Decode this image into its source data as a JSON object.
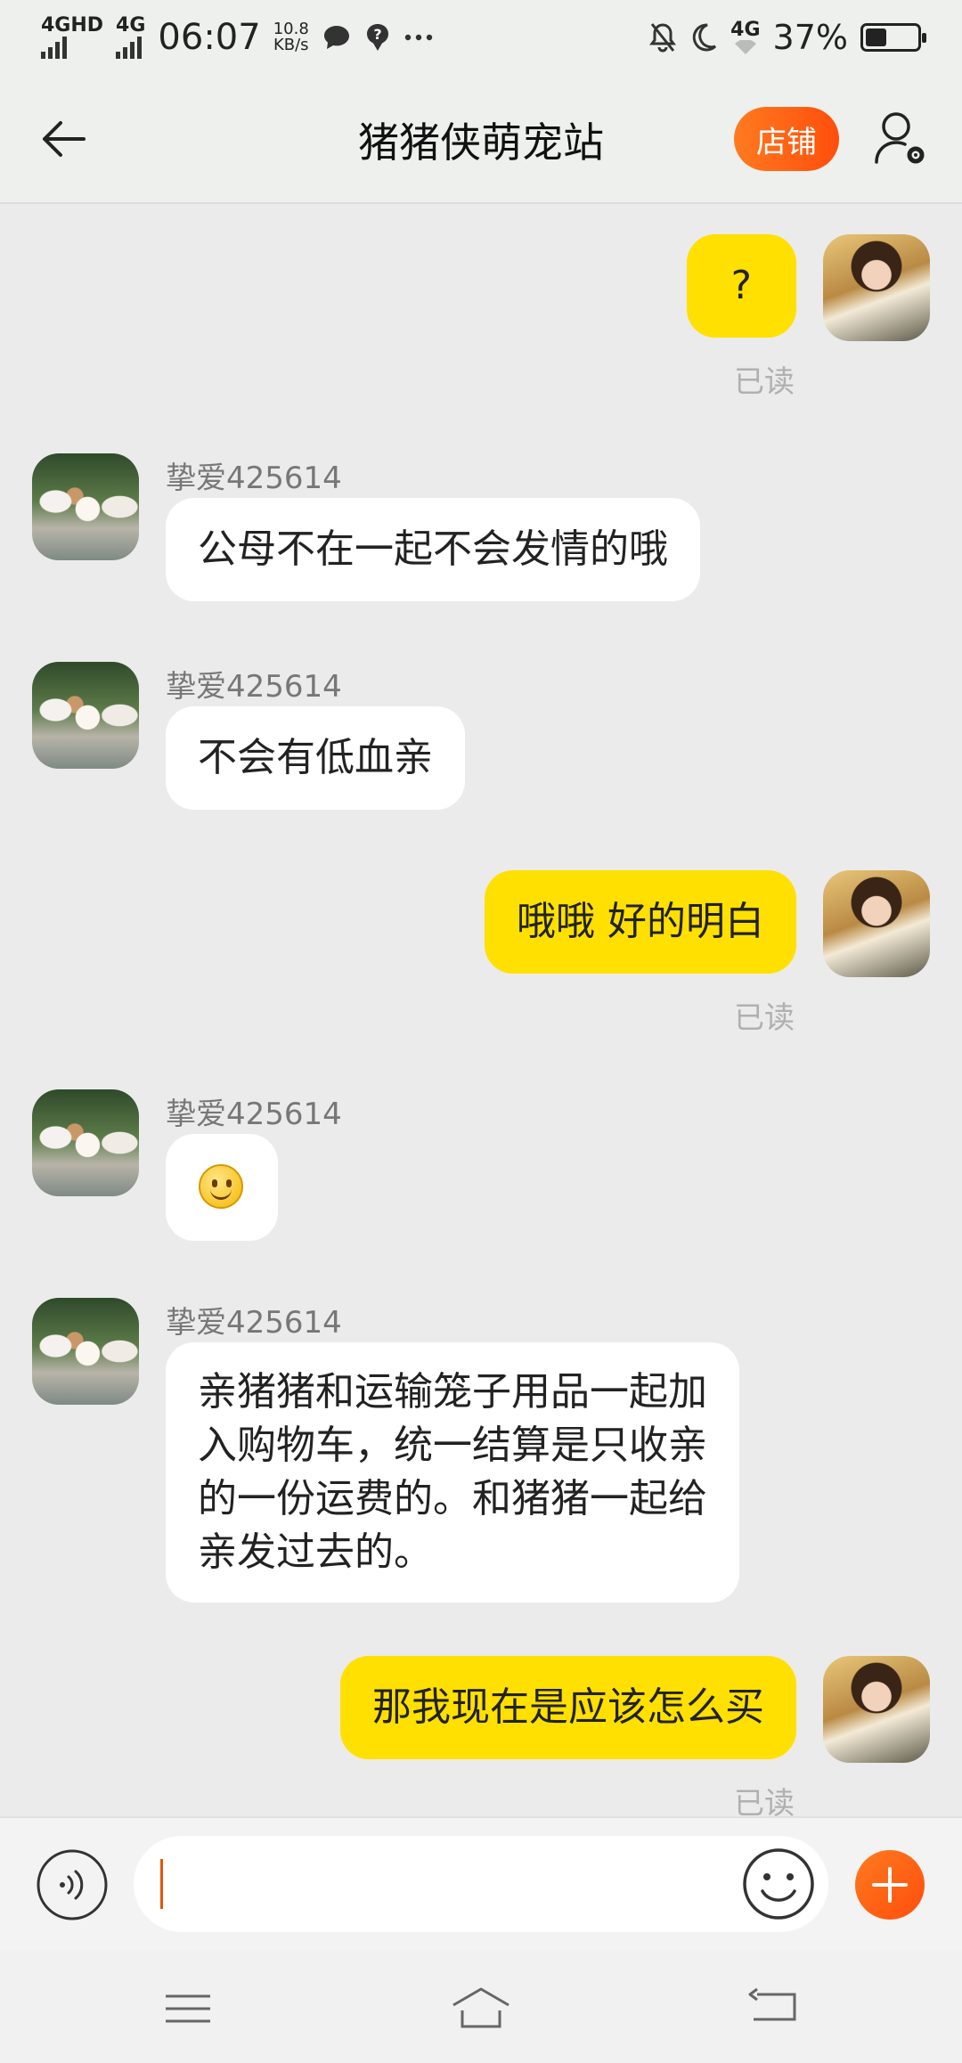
{
  "status_bar": {
    "network_1": "4GHD",
    "network_2": "4G",
    "time": "06:07",
    "speed_value": "10.8",
    "speed_unit": "KB/s",
    "network_3": "4G",
    "battery": "37%",
    "battery_level": 0.37
  },
  "header": {
    "title": "猪猪侠萌宠站",
    "shop_button": "店铺"
  },
  "messages": [
    {
      "from": "me",
      "text": "?",
      "read": "已读"
    },
    {
      "from": "shop",
      "sender": "挚爱425614",
      "text": "公母不在一起不会发情的哦"
    },
    {
      "from": "shop",
      "sender": "挚爱425614",
      "text": "不会有低血亲"
    },
    {
      "from": "me",
      "text": "哦哦 好的明白",
      "read": "已读"
    },
    {
      "from": "shop",
      "sender": "挚爱425614",
      "emoji": "smiling-face"
    },
    {
      "from": "shop",
      "sender": "挚爱425614",
      "lines": [
        "亲猪猪和运输笼子用品一起加",
        "入购物车，统一结算是只收亲",
        "的一份运费的。和猪猪一起给",
        "亲发过去的。"
      ]
    },
    {
      "from": "me",
      "text": "那我现在是应该怎么买",
      "read": "已读"
    }
  ],
  "input": {
    "value": "",
    "placeholder": ""
  },
  "colors": {
    "my_bubble": "#ffe000",
    "their_bubble": "#ffffff",
    "accent": "#ff5a10",
    "background": "#ebebeb"
  }
}
